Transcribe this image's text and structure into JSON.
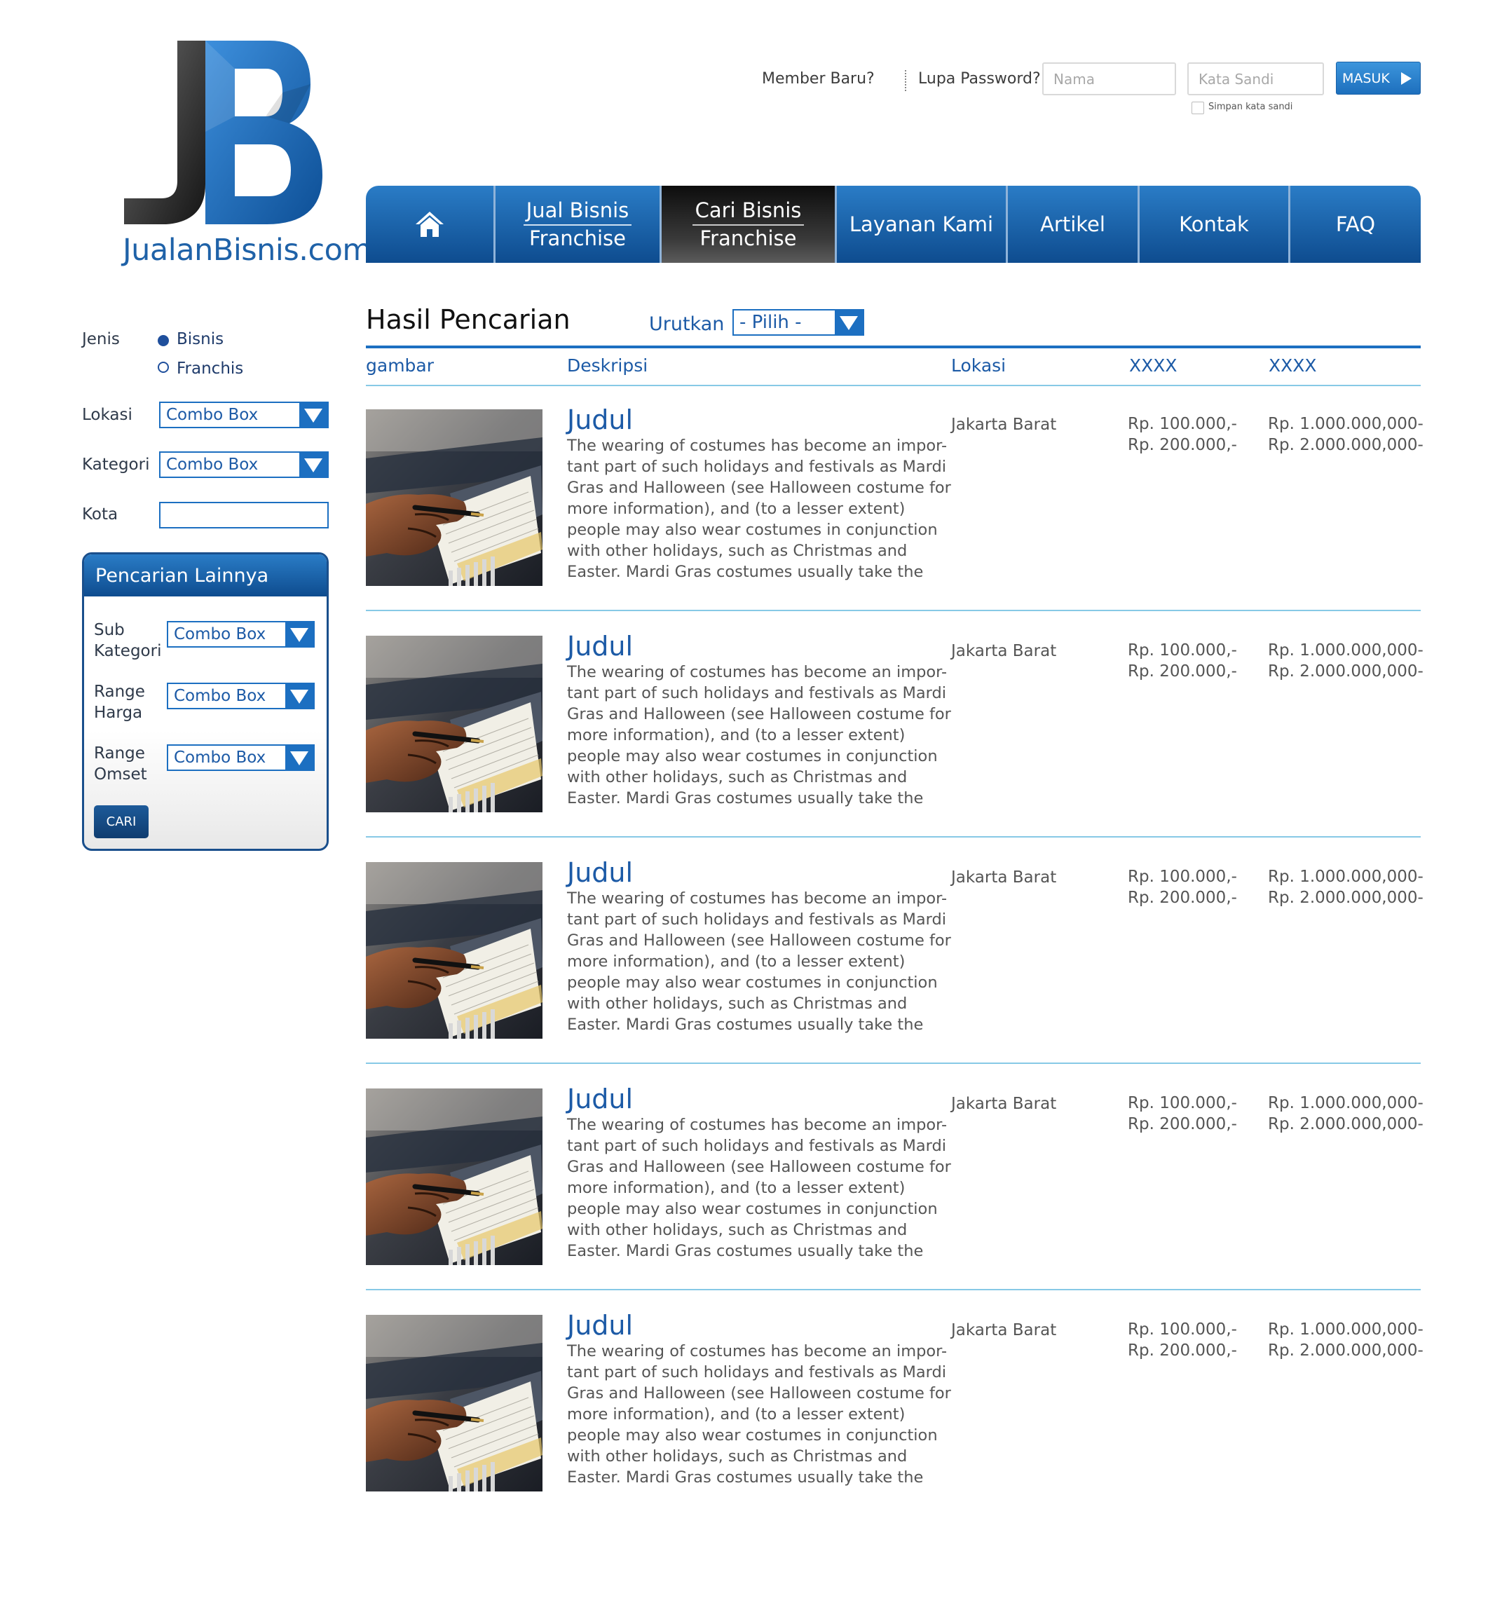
{
  "logo": {
    "text": "JualanBisnis.com"
  },
  "login": {
    "member_baru": "Member Baru?",
    "lupa_password": "Lupa Password?",
    "nama_placeholder": "Nama",
    "sandi_placeholder": "Kata Sandi",
    "remember_label": "Simpan kata sandi",
    "button_label": "MASUK"
  },
  "nav": {
    "items": [
      {
        "icon": "home-icon"
      },
      {
        "line1": "Jual Bisnis",
        "line2": "Franchise"
      },
      {
        "line1": "Cari Bisnis",
        "line2": "Franchise"
      },
      {
        "label": "Layanan Kami"
      },
      {
        "label": "Artikel"
      },
      {
        "label": "Kontak"
      },
      {
        "label": "FAQ"
      }
    ],
    "active_index": 2
  },
  "sidebar": {
    "jenis_label": "Jenis",
    "jenis_options": [
      {
        "label": "Bisnis",
        "selected": true
      },
      {
        "label": "Franchis",
        "selected": false
      }
    ],
    "lokasi_label": "Lokasi",
    "lokasi_value": "Combo Box",
    "kategori_label": "Kategori",
    "kategori_value": "Combo Box",
    "kota_label": "Kota",
    "kota_value": "",
    "panel": {
      "title": "Pencarian Lainnya",
      "fields": [
        {
          "label_line1": "Sub",
          "label_line2": "Kategori",
          "value": "Combo Box"
        },
        {
          "label_line1": "Range",
          "label_line2": "Harga",
          "value": "Combo Box"
        },
        {
          "label_line1": "Range",
          "label_line2": "Omset",
          "value": "Combo Box"
        }
      ],
      "button_label": "CARI"
    }
  },
  "results": {
    "title": "Hasil Pencarian",
    "sort_label": "Urutkan",
    "sort_value": "- Pilih -",
    "columns": [
      "gambar",
      "Deskripsi",
      "Lokasi",
      "XXXX",
      "XXXX"
    ],
    "rows": [
      {
        "title": "Judul",
        "description_lines": [
          "The wearing of costumes has become an impor-",
          "tant part of such holidays and festivals as Mardi",
          "Gras and Halloween (see Halloween costume for",
          "more information), and (to a lesser extent)",
          "people may also wear costumes in conjunction",
          "with other holidays, such as Christmas and",
          "Easter. Mardi Gras costumes usually take the"
        ],
        "location": "Jakarta Barat",
        "price_1": "Rp. 100.000,-",
        "price_2": "Rp. 200.000,-",
        "omset_1": "Rp. 1.000.000,000-",
        "omset_2": "Rp. 2.000.000,000-"
      },
      {
        "title": "Judul",
        "description_lines": [
          "The wearing of costumes has become an impor-",
          "tant part of such holidays and festivals as Mardi",
          "Gras and Halloween (see Halloween costume for",
          "more information), and (to a lesser extent)",
          "people may also wear costumes in conjunction",
          "with other holidays, such as Christmas and",
          "Easter. Mardi Gras costumes usually take the"
        ],
        "location": "Jakarta Barat",
        "price_1": "Rp. 100.000,-",
        "price_2": "Rp. 200.000,-",
        "omset_1": "Rp. 1.000.000,000-",
        "omset_2": "Rp. 2.000.000,000-"
      },
      {
        "title": "Judul",
        "description_lines": [
          "The wearing of costumes has become an impor-",
          "tant part of such holidays and festivals as Mardi",
          "Gras and Halloween (see Halloween costume for",
          "more information), and (to a lesser extent)",
          "people may also wear costumes in conjunction",
          "with other holidays, such as Christmas and",
          "Easter. Mardi Gras costumes usually take the"
        ],
        "location": "Jakarta Barat",
        "price_1": "Rp. 100.000,-",
        "price_2": "Rp. 200.000,-",
        "omset_1": "Rp. 1.000.000,000-",
        "omset_2": "Rp. 2.000.000,000-"
      },
      {
        "title": "Judul",
        "description_lines": [
          "The wearing of costumes has become an impor-",
          "tant part of such holidays and festivals as Mardi",
          "Gras and Halloween (see Halloween costume for",
          "more information), and (to a lesser extent)",
          "people may also wear costumes in conjunction",
          "with other holidays, such as Christmas and",
          "Easter. Mardi Gras costumes usually take the"
        ],
        "location": "Jakarta Barat",
        "price_1": "Rp. 100.000,-",
        "price_2": "Rp. 200.000,-",
        "omset_1": "Rp. 1.000.000,000-",
        "omset_2": "Rp. 2.000.000,000-"
      },
      {
        "title": "Judul",
        "description_lines": [
          "The wearing of costumes has become an impor-",
          "tant part of such holidays and festivals as Mardi",
          "Gras and Halloween (see Halloween costume for",
          "more information), and (to a lesser extent)",
          "people may also wear costumes in conjunction",
          "with other holidays, such as Christmas and",
          "Easter. Mardi Gras costumes usually take the"
        ],
        "location": "Jakarta Barat",
        "price_1": "Rp. 100.000,-",
        "price_2": "Rp. 200.000,-",
        "omset_1": "Rp. 1.000.000,000-",
        "omset_2": "Rp. 2.000.000,000-"
      }
    ]
  },
  "colors": {
    "brand_blue": "#1c6fc1",
    "nav_dark_blue": "#0e4c8f",
    "text_blue": "#1c5aa6",
    "divider": "#87c9e6"
  }
}
